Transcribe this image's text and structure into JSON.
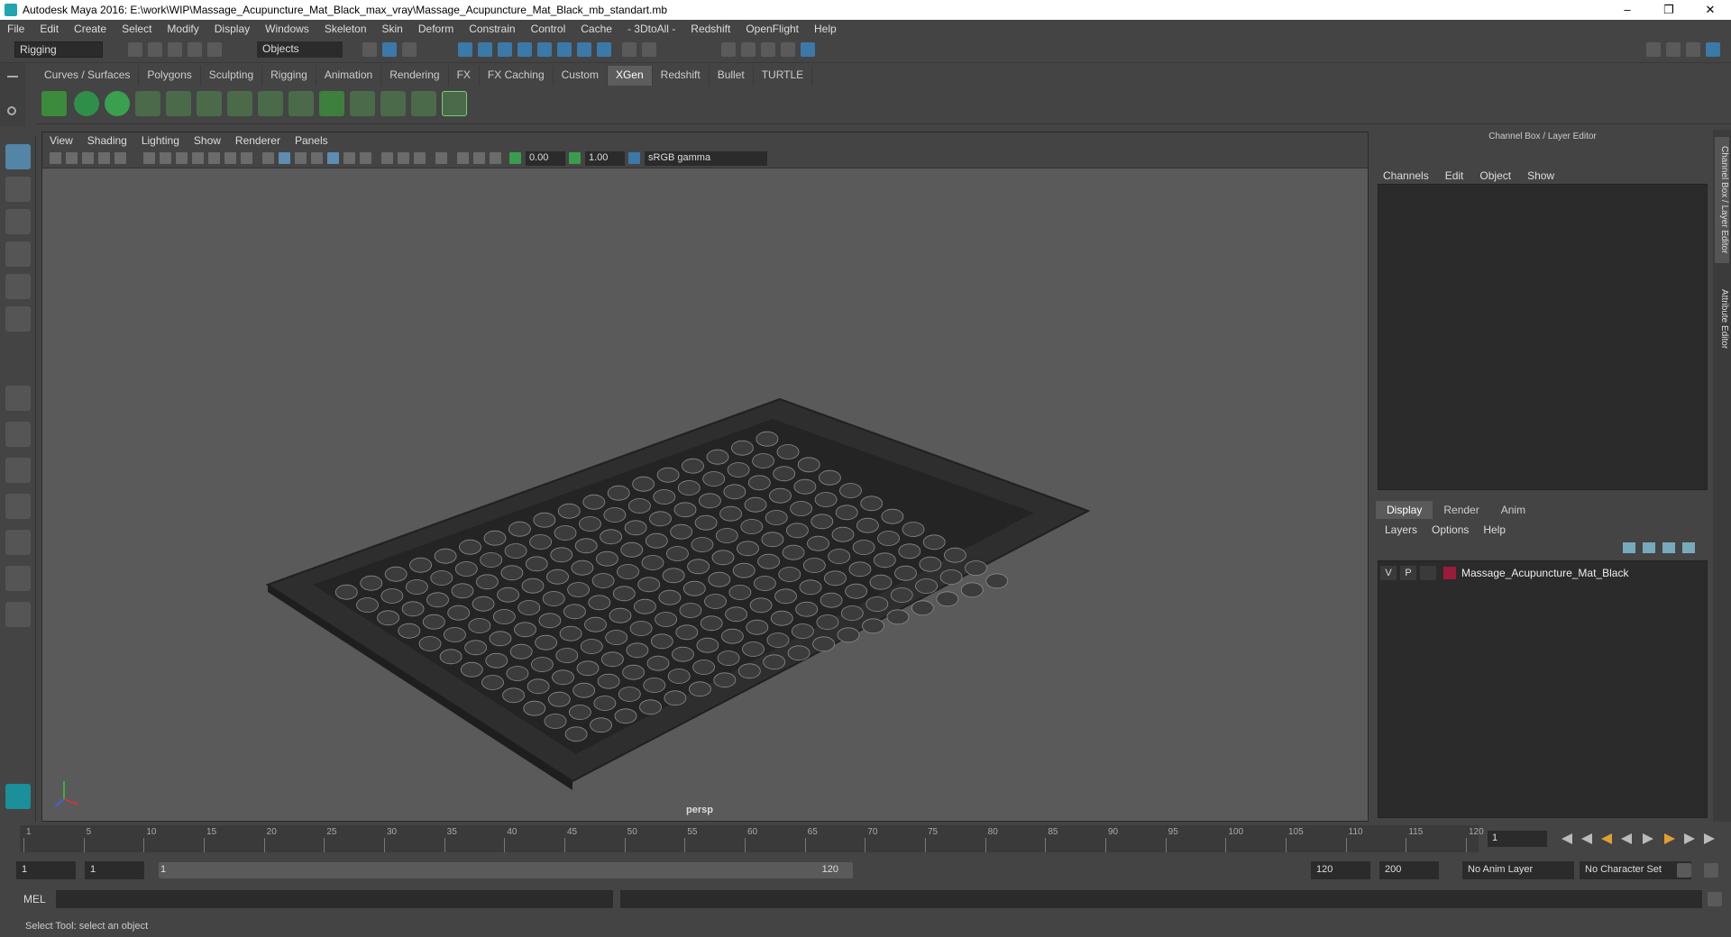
{
  "window": {
    "title": "Autodesk Maya 2016: E:\\work\\WIP\\Massage_Acupuncture_Mat_Black_max_vray\\Massage_Acupuncture_Mat_Black_mb_standart.mb",
    "minimize": "–",
    "maximize": "❐",
    "close": "✕"
  },
  "menubar": [
    "File",
    "Edit",
    "Create",
    "Select",
    "Modify",
    "Display",
    "Windows",
    "Skeleton",
    "Skin",
    "Deform",
    "Constrain",
    "Control",
    "Cache",
    "- 3DtoAll -",
    "Redshift",
    "OpenFlight",
    "Help"
  ],
  "statusline": {
    "mode": "Rigging",
    "object_selector": "Objects"
  },
  "shelf_tabs": [
    "Curves / Surfaces",
    "Polygons",
    "Sculpting",
    "Rigging",
    "Animation",
    "Rendering",
    "FX",
    "FX Caching",
    "Custom",
    "XGen",
    "Redshift",
    "Bullet",
    "TURTLE"
  ],
  "shelf_active": "XGen",
  "viewport": {
    "menu": [
      "View",
      "Shading",
      "Lighting",
      "Show",
      "Renderer",
      "Panels"
    ],
    "exposure": "0.00",
    "gamma": "1.00",
    "color_space": "sRGB gamma",
    "camera": "persp"
  },
  "channel_box": {
    "title": "Channel Box / Layer Editor",
    "menu": [
      "Channels",
      "Edit",
      "Object",
      "Show"
    ]
  },
  "layer_editor": {
    "tabs": [
      "Display",
      "Render",
      "Anim"
    ],
    "active_tab": "Display",
    "menu": [
      "Layers",
      "Options",
      "Help"
    ],
    "layers": [
      {
        "v": "V",
        "p": "P",
        "name": "Massage_Acupuncture_Mat_Black",
        "color": "#9b1b3a"
      }
    ]
  },
  "side_tabs": [
    "Channel Box / Layer Editor",
    "Attribute Editor"
  ],
  "timeline": {
    "ticks": [
      "1",
      "5",
      "10",
      "15",
      "20",
      "25",
      "30",
      "35",
      "40",
      "45",
      "50",
      "55",
      "60",
      "65",
      "70",
      "75",
      "80",
      "85",
      "90",
      "95",
      "100",
      "105",
      "110",
      "115",
      "120"
    ],
    "current_frame": "1"
  },
  "range": {
    "start": "1",
    "playback_start": "1",
    "bar_start": "1",
    "bar_end": "120",
    "playback_end": "120",
    "end": "200",
    "anim_layer": "No Anim Layer",
    "character_set": "No Character Set"
  },
  "command": {
    "label": "MEL"
  },
  "help_line": "Select Tool: select an object"
}
